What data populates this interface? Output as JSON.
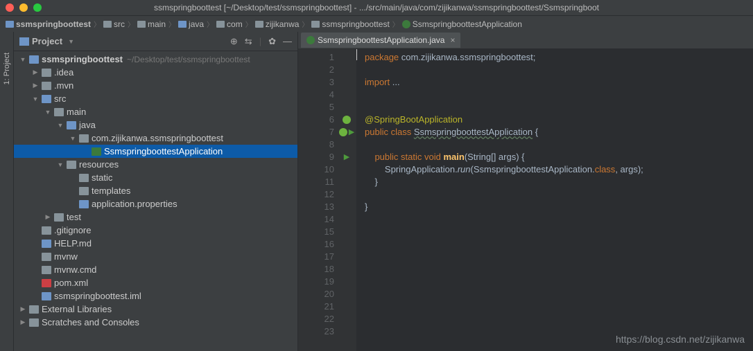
{
  "window": {
    "title": "ssmspringboottest [~/Desktop/test/ssmspringboottest] - .../src/main/java/com/zijikanwa/ssmspringboottest/Ssmspringboot"
  },
  "breadcrumbs": [
    {
      "label": "ssmspringboottest",
      "icon": "blue"
    },
    {
      "label": "src",
      "icon": "gray"
    },
    {
      "label": "main",
      "icon": "gray"
    },
    {
      "label": "java",
      "icon": "blue"
    },
    {
      "label": "com",
      "icon": "gray"
    },
    {
      "label": "zijikanwa",
      "icon": "gray"
    },
    {
      "label": "ssmspringboottest",
      "icon": "gray"
    },
    {
      "label": "SsmspringboottestApplication",
      "icon": "class"
    }
  ],
  "sidebar": {
    "tab_label": "1: Project"
  },
  "project_panel": {
    "title": "Project",
    "tree": [
      {
        "depth": 0,
        "arrow": "▼",
        "icon": "f-bluefolder",
        "label": "ssmspringboottest",
        "hint": "~/Desktop/test/ssmspringboottest",
        "bold": true
      },
      {
        "depth": 1,
        "arrow": "▶",
        "icon": "f-folder",
        "label": ".idea"
      },
      {
        "depth": 1,
        "arrow": "▶",
        "icon": "f-folder",
        "label": ".mvn"
      },
      {
        "depth": 1,
        "arrow": "▼",
        "icon": "f-bluefolder",
        "label": "src"
      },
      {
        "depth": 2,
        "arrow": "▼",
        "icon": "f-folder",
        "label": "main"
      },
      {
        "depth": 3,
        "arrow": "▼",
        "icon": "f-bluefolder",
        "label": "java"
      },
      {
        "depth": 4,
        "arrow": "▼",
        "icon": "f-pkg",
        "label": "com.zijikanwa.ssmspringboottest"
      },
      {
        "depth": 5,
        "arrow": "",
        "icon": "f-class",
        "label": "SsmspringboottestApplication",
        "selected": true
      },
      {
        "depth": 3,
        "arrow": "▼",
        "icon": "f-folder",
        "label": "resources"
      },
      {
        "depth": 4,
        "arrow": "",
        "icon": "f-folder",
        "label": "static"
      },
      {
        "depth": 4,
        "arrow": "",
        "icon": "f-folder",
        "label": "templates"
      },
      {
        "depth": 4,
        "arrow": "",
        "icon": "f-file",
        "label": "application.properties"
      },
      {
        "depth": 2,
        "arrow": "▶",
        "icon": "f-folder",
        "label": "test"
      },
      {
        "depth": 1,
        "arrow": "",
        "icon": "f-txt",
        "label": ".gitignore"
      },
      {
        "depth": 1,
        "arrow": "",
        "icon": "f-file",
        "label": "HELP.md"
      },
      {
        "depth": 1,
        "arrow": "",
        "icon": "f-txt",
        "label": "mvnw"
      },
      {
        "depth": 1,
        "arrow": "",
        "icon": "f-txt",
        "label": "mvnw.cmd"
      },
      {
        "depth": 1,
        "arrow": "",
        "icon": "f-m",
        "label": "pom.xml",
        "italic": true,
        "label_prefix": "m "
      },
      {
        "depth": 1,
        "arrow": "",
        "icon": "f-file",
        "label": "ssmspringboottest.iml"
      },
      {
        "depth": 0,
        "arrow": "▶",
        "icon": "f-folder",
        "label": "External Libraries"
      },
      {
        "depth": 0,
        "arrow": "▶",
        "icon": "f-folder",
        "label": "Scratches and Consoles"
      }
    ]
  },
  "editor": {
    "tab": {
      "label": "SsmspringboottestApplication.java"
    },
    "lines": [
      "1",
      "2",
      "3",
      "4",
      "5",
      "6",
      "7",
      "8",
      "9",
      "10",
      "11",
      "12",
      "13",
      "14",
      "15",
      "16",
      "17",
      "18",
      "19",
      "20",
      "21",
      "22",
      "23"
    ],
    "code": {
      "l1": "package com.zijikanwa.ssmspringboottest;",
      "l3a": "import ",
      "l3b": "...",
      "l6": "@SpringBootApplication",
      "l7a": "public class ",
      "l7b": "SsmspringboottestApplication",
      "l7c": " {",
      "l9a": "    public static void ",
      "l9b": "main",
      "l9c": "(String[] args) {",
      "l10": "        SpringApplication.run(SsmspringboottestApplication.class, args);",
      "l11": "    }",
      "l13": "}"
    }
  },
  "watermark": "https://blog.csdn.net/zijikanwa"
}
